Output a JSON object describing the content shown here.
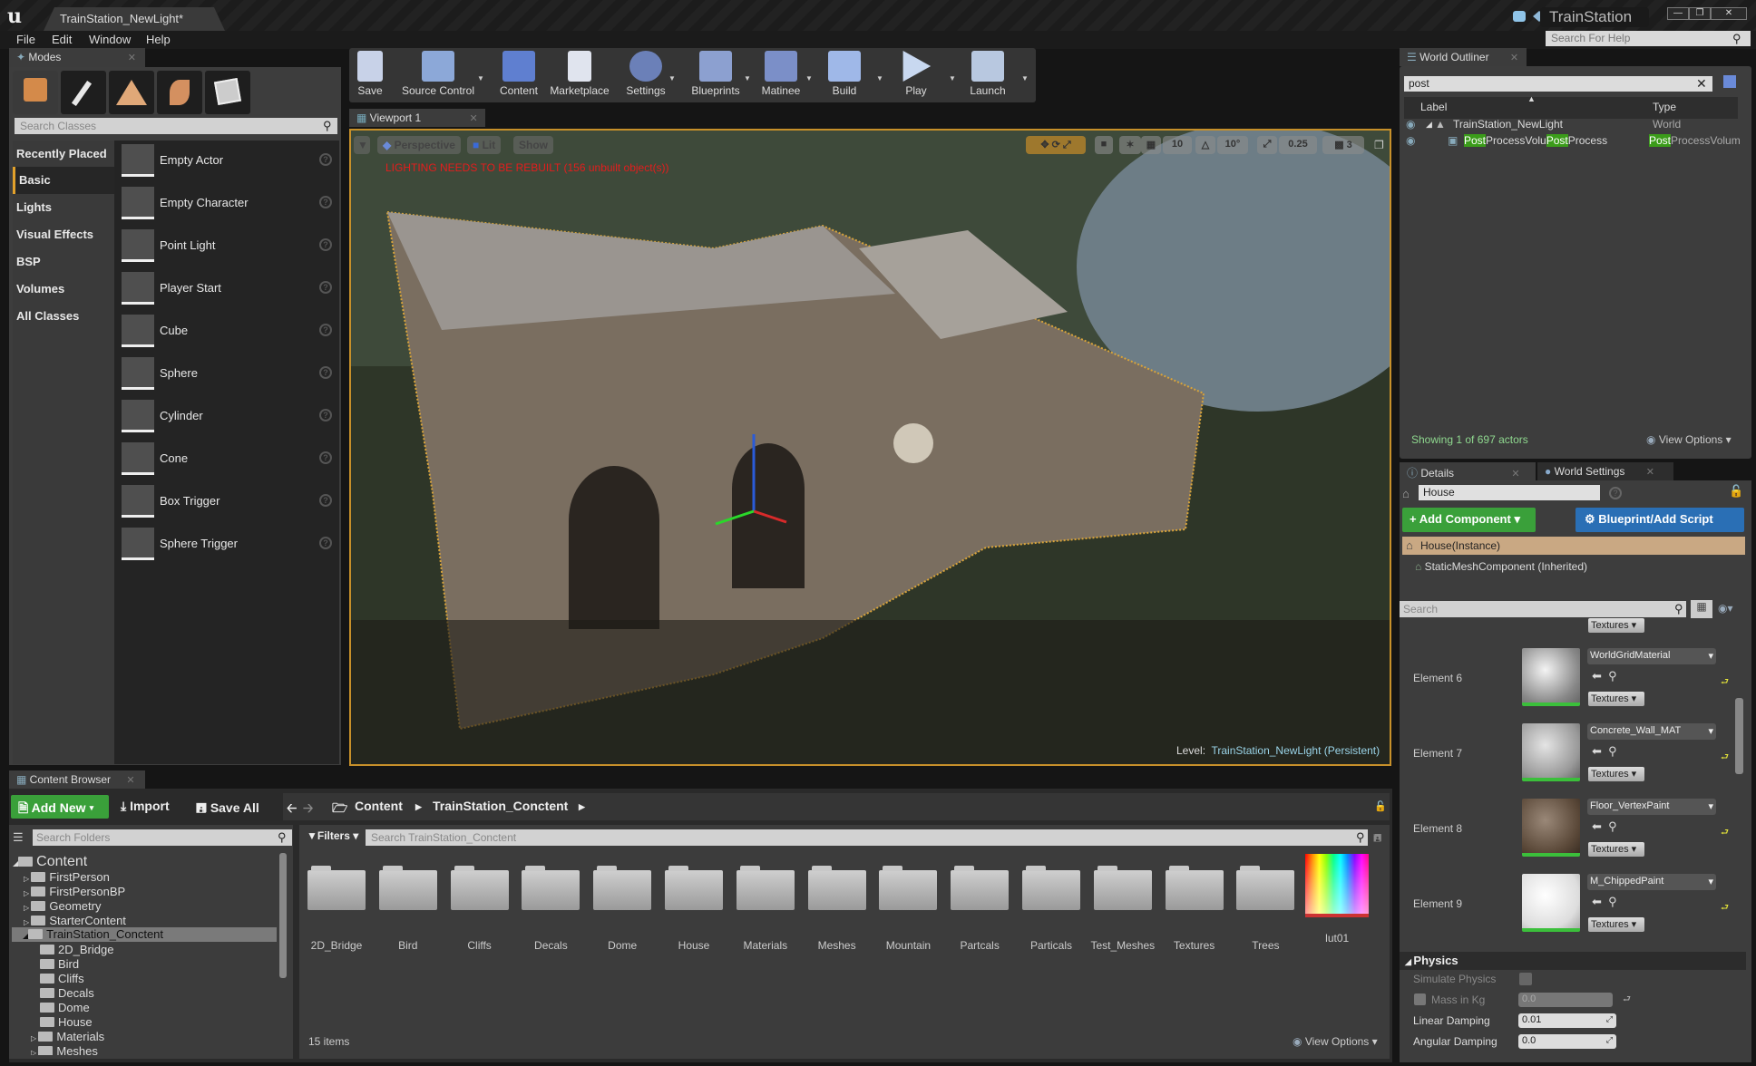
{
  "window": {
    "title": "TrainStation_NewLight*",
    "project": "TrainStation",
    "controls": [
      "minimize",
      "restore",
      "close"
    ]
  },
  "menu": [
    "File",
    "Edit",
    "Window",
    "Help"
  ],
  "help_search": {
    "placeholder": "Search For Help"
  },
  "modes": {
    "tab": "Modes",
    "mode_icons": [
      "place-mode-icon",
      "paint-mode-icon",
      "landscape-mode-icon",
      "foliage-mode-icon",
      "geometry-mode-icon"
    ],
    "search_placeholder": "Search Classes",
    "categories": [
      "Recently Placed",
      "Basic",
      "Lights",
      "Visual Effects",
      "BSP",
      "Volumes",
      "All Classes"
    ],
    "selected_category": "Basic",
    "items": [
      "Empty Actor",
      "Empty Character",
      "Point Light",
      "Player Start",
      "Cube",
      "Sphere",
      "Cylinder",
      "Cone",
      "Box Trigger",
      "Sphere Trigger"
    ]
  },
  "toolbar": [
    "Save",
    "Source Control",
    "Content",
    "Marketplace",
    "Settings",
    "Blueprints",
    "Matinee",
    "Build",
    "Play",
    "Launch"
  ],
  "viewport": {
    "tab": "Viewport 1",
    "view_mode": "Perspective",
    "lighting": "Lit",
    "show": "Show",
    "warning": "LIGHTING NEEDS TO BE REBUILT (156 unbuilt object(s))",
    "grid_snap": "10",
    "rotation_snap": "10°",
    "scale_snap": "0.25",
    "camera_speed": "3",
    "level_label": "Level:",
    "level_name": "TrainStation_NewLight (Persistent)"
  },
  "outliner": {
    "tab": "World Outliner",
    "search_value": "post",
    "columns": [
      "Label",
      "Type"
    ],
    "rows": [
      {
        "label": "TrainStation_NewLight",
        "type": "World"
      },
      {
        "label_prefix": "Post",
        "label_mid": "ProcessVolu",
        "label_prefix2": "Post",
        "label_rest": "ProcessVolume",
        "type_prefix": "Post",
        "type_rest": "ProcessVolum"
      }
    ],
    "status": "Showing 1 of 697 actors",
    "view_options": "View Options"
  },
  "details": {
    "tab": "Details",
    "tab2": "World Settings",
    "name_value": "House",
    "add_component": "+ Add Component",
    "blueprint_script": "Blueprint/Add Script",
    "instance": "House(Instance)",
    "component": "StaticMeshComponent (Inherited)",
    "search_placeholder": "Search",
    "elements": [
      {
        "label": "Element 6",
        "material": "WorldGridMaterial",
        "button": "Textures"
      },
      {
        "label": "Element 7",
        "material": "Concrete_Wall_MAT",
        "button": "Textures"
      },
      {
        "label": "Element 8",
        "material": "Floor_VertexPaint",
        "button": "Textures"
      },
      {
        "label": "Element 9",
        "material": "M_ChippedPaint",
        "button": "Textures"
      }
    ],
    "physics": {
      "header": "Physics",
      "simulate_label": "Simulate Physics",
      "simulate_checked": false,
      "mass_label": "Mass in Kg",
      "mass_value": "0.0",
      "linear_label": "Linear Damping",
      "linear_value": "0.01",
      "angular_label": "Angular Damping",
      "angular_value": "0.0"
    }
  },
  "content_browser": {
    "tab": "Content Browser",
    "add_new": "Add New",
    "import": "Import",
    "save_all": "Save All",
    "breadcrumb": [
      "Content",
      "TrainStation_Conctent"
    ],
    "search_folders": "Search Folders",
    "filters": "Filters",
    "search_assets": "Search TrainStation_Conctent",
    "tree": [
      {
        "label": "Content",
        "level": 0,
        "expanded": true
      },
      {
        "label": "FirstPerson",
        "level": 1
      },
      {
        "label": "FirstPersonBP",
        "level": 1
      },
      {
        "label": "Geometry",
        "level": 1
      },
      {
        "label": "StarterContent",
        "level": 1
      },
      {
        "label": "TrainStation_Conctent",
        "level": 1,
        "expanded": true,
        "selected": true
      },
      {
        "label": "2D_Bridge",
        "level": 2
      },
      {
        "label": "Bird",
        "level": 2
      },
      {
        "label": "Cliffs",
        "level": 2
      },
      {
        "label": "Decals",
        "level": 2
      },
      {
        "label": "Dome",
        "level": 2
      },
      {
        "label": "House",
        "level": 2
      },
      {
        "label": "Materials",
        "level": 2
      },
      {
        "label": "Meshes",
        "level": 2
      }
    ],
    "assets": [
      "2D_Bridge",
      "Bird",
      "Cliffs",
      "Decals",
      "Dome",
      "House",
      "Materials",
      "Meshes",
      "Mountain",
      "Partcals",
      "Particals",
      "Test_Meshes",
      "Textures",
      "Trees",
      "lut01"
    ],
    "item_count": "15 items",
    "view_options": "View Options"
  }
}
